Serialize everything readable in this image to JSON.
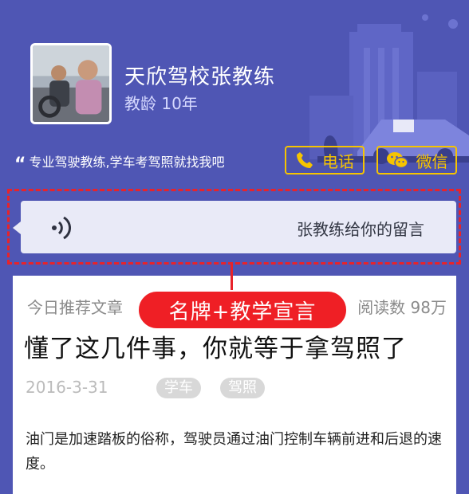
{
  "header": {
    "coach_name": "天欣驾校张教练",
    "experience": "教龄 10年",
    "slogan": "专业驾驶教练,学车考驾照就找我吧",
    "phone_label": "电话",
    "wechat_label": "微信"
  },
  "message": {
    "text": "张教练给你的留言"
  },
  "article": {
    "section_label": "今日推荐文章",
    "read_count": "阅读数 98万",
    "title": "懂了这几件事，你就等于拿驾照了",
    "date": "2016-3-31",
    "tags": [
      "学车",
      "驾照"
    ],
    "excerpt": "油门是加速踏板的俗称，驾驶员通过油门控制车辆前进和后退的速度。"
  },
  "annotation": {
    "label": "名牌+教学宣言"
  },
  "colors": {
    "background": "#4f56b4",
    "accent_yellow": "#f6c400",
    "annotation_red": "#ef1f25"
  }
}
